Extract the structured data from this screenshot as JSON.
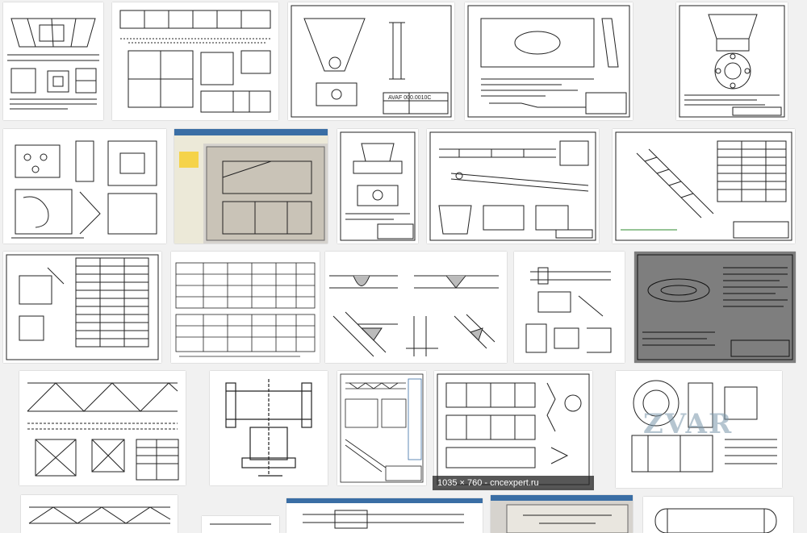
{
  "results": {
    "caption": "1035 × 760 - cncexpert.ru",
    "watermark": "ZVAR",
    "tiles": [
      {
        "id": "drawing-1"
      },
      {
        "id": "drawing-2"
      },
      {
        "id": "drawing-3"
      },
      {
        "id": "drawing-4"
      },
      {
        "id": "drawing-5"
      },
      {
        "id": "drawing-6"
      },
      {
        "id": "drawing-7"
      },
      {
        "id": "drawing-8"
      },
      {
        "id": "drawing-9"
      },
      {
        "id": "drawing-10"
      },
      {
        "id": "drawing-11"
      },
      {
        "id": "drawing-12"
      },
      {
        "id": "drawing-13"
      },
      {
        "id": "drawing-14"
      },
      {
        "id": "drawing-15"
      },
      {
        "id": "drawing-16"
      },
      {
        "id": "drawing-17"
      },
      {
        "id": "drawing-18"
      },
      {
        "id": "drawing-19"
      },
      {
        "id": "drawing-20"
      },
      {
        "id": "drawing-21"
      },
      {
        "id": "drawing-22"
      },
      {
        "id": "drawing-23"
      },
      {
        "id": "drawing-24"
      },
      {
        "id": "drawing-25"
      }
    ]
  },
  "colors": {
    "page_background": "#f1f1f1",
    "tile_background": "#ffffff",
    "line_color": "#222222",
    "gray_tile": "#7e7e7e",
    "cad_window": "#d6d3ce"
  }
}
